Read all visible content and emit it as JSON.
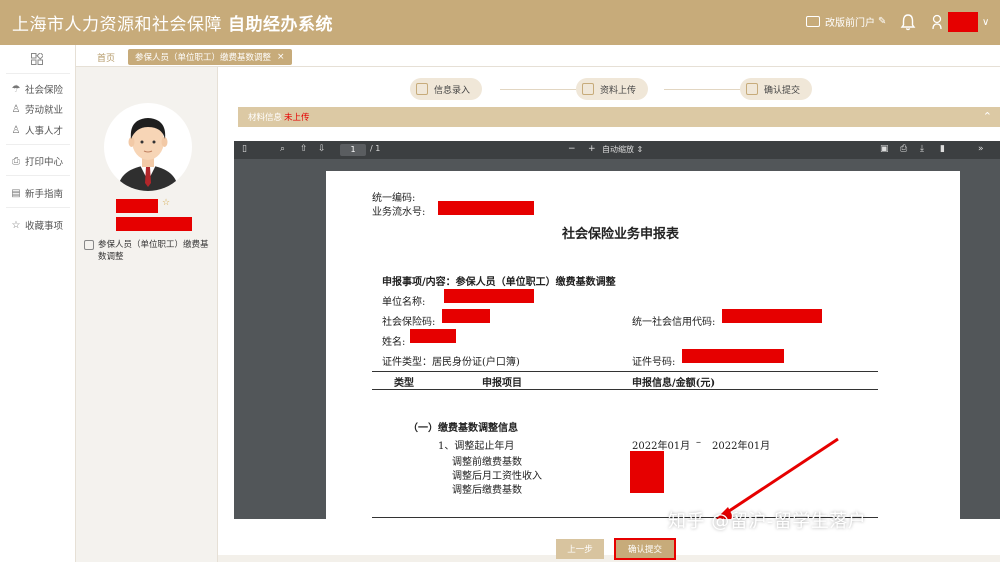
{
  "header": {
    "system_name": "上海市人力资源和社会保障",
    "app_name": "自助经办系统",
    "portal_label": "改版前门户",
    "accent_color": "#c7ab7a"
  },
  "leftnav": {
    "items": [
      {
        "label": "社会保险",
        "icon": "umbrella-icon"
      },
      {
        "label": "劳动就业",
        "icon": "person-icon"
      },
      {
        "label": "人事人才",
        "icon": "people-icon"
      },
      {
        "label": "打印中心",
        "icon": "printer-icon"
      },
      {
        "label": "新手指南",
        "icon": "guide-icon"
      },
      {
        "label": "收藏事项",
        "icon": "star-icon"
      }
    ]
  },
  "profile": {
    "business_item": "参保人员（单位职工）缴费基数调整"
  },
  "tabs": {
    "home": "首页",
    "active": "参保人员（单位职工）缴费基数调整",
    "close": "×"
  },
  "steps": [
    {
      "label": "信息录入"
    },
    {
      "label": "资料上传"
    },
    {
      "label": "确认提交"
    }
  ],
  "material": {
    "label": "材料信息",
    "status": "未上传"
  },
  "pdf_toolbar": {
    "page_input": "1",
    "page_total": "/ 1",
    "zoom_mode": "自动缩放"
  },
  "document": {
    "unified_code_label": "统一编码:",
    "serial_label": "业务流水号:",
    "title": "社会保险业务申报表",
    "declare_item": "申报事项/内容：参保人员（单位职工）缴费基数调整",
    "company_name_label": "单位名称:",
    "si_code_label": "社会保险码:",
    "credit_code_label": "统一社会信用代码:",
    "name_label": "姓名:",
    "id_type": "证件类型：居民身份证(户口簿)",
    "id_number_label": "证件号码:",
    "table_headers": [
      "类型",
      "申报项目",
      "申报信息/金额(元)"
    ],
    "section_title": "（一）缴费基数调整信息",
    "rows": [
      "1、调整起止年月",
      "调整前缴费基数",
      "调整后月工资性收入",
      "调整后缴费基数"
    ],
    "date_from": "2022年01月",
    "date_sep": "–",
    "date_to": "2022年01月"
  },
  "buttons": {
    "prev": "上一步",
    "confirm": "确认提交"
  },
  "watermark": "知乎 @留沪-留学生落户"
}
